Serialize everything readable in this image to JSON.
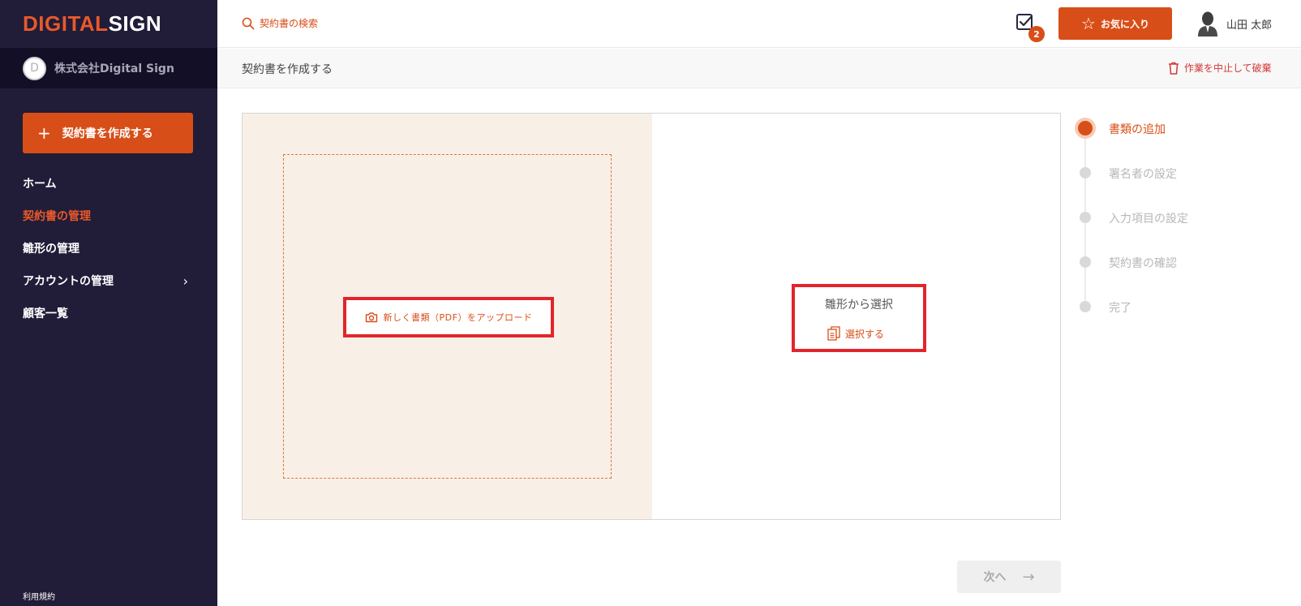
{
  "app": {
    "logo_part1": "DIGITAL",
    "logo_part2": "SIGN"
  },
  "company": {
    "initial": "D",
    "name": "株式会社Digital Sign"
  },
  "sidebar": {
    "create_button": "契約書を作成する",
    "items": [
      {
        "label": "ホーム",
        "active": false
      },
      {
        "label": "契約書の管理",
        "active": true
      },
      {
        "label": "雛形の管理",
        "active": false
      },
      {
        "label": "アカウントの管理",
        "active": false,
        "has_submenu": true
      },
      {
        "label": "顧客一覧",
        "active": false
      }
    ],
    "terms": "利用規約"
  },
  "header": {
    "search_placeholder": "契約書の検索",
    "task_badge": "2",
    "favorites_label": "お気に入り",
    "user_name": "山田 太郎"
  },
  "subheader": {
    "title": "契約書を作成する",
    "discard_label": "作業を中止して破棄"
  },
  "main": {
    "upload_label": "新しく書類（PDF）をアップロード",
    "template_heading": "雛形から選択",
    "template_select_label": "選択する",
    "next_label": "次へ"
  },
  "stepper": {
    "steps": [
      {
        "label": "書類の追加",
        "active": true
      },
      {
        "label": "署名者の設定",
        "active": false
      },
      {
        "label": "入力項目の設定",
        "active": false
      },
      {
        "label": "契約書の確認",
        "active": false
      },
      {
        "label": "完了",
        "active": false
      }
    ]
  },
  "colors": {
    "accent": "#d84e18",
    "sidebar_bg": "#211c38",
    "highlight_border": "#e2252b",
    "danger": "#d23838"
  }
}
